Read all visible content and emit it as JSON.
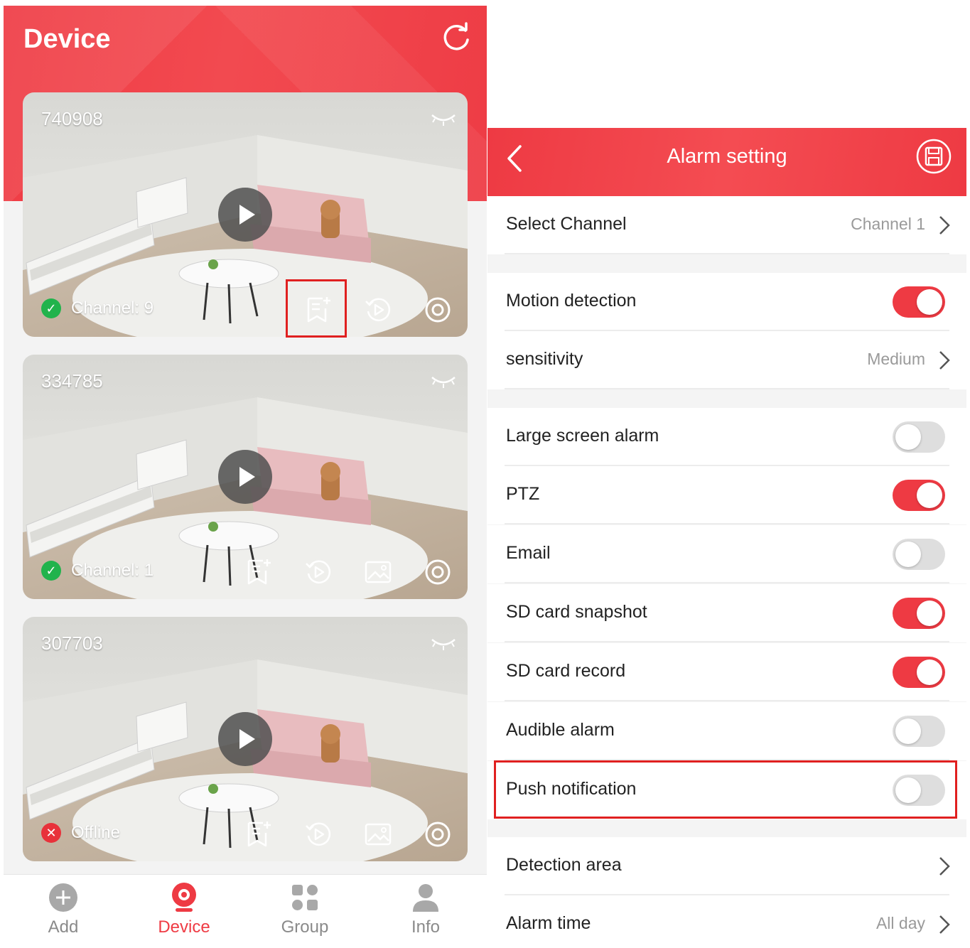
{
  "colors": {
    "accent": "#ee3a43",
    "online": "#21b34c",
    "offline": "#e8313a",
    "highlight": "#e02020"
  },
  "left": {
    "title": "Device",
    "refresh_icon": "refresh-icon",
    "cameras": [
      {
        "id": "740908",
        "status": "Channel: 9",
        "online": true,
        "actions": [
          "add-record-icon",
          "playback-icon",
          "settings-icon"
        ]
      },
      {
        "id": "334785",
        "status": "Channel: 1",
        "online": true,
        "actions": [
          "add-record-icon",
          "playback-icon",
          "image-icon",
          "settings-icon"
        ]
      },
      {
        "id": "307703",
        "status": "Offline",
        "online": false,
        "actions": [
          "add-record-icon",
          "playback-icon",
          "image-icon",
          "settings-icon"
        ]
      }
    ],
    "tabs": [
      {
        "label": "Add",
        "icon": "add-icon",
        "active": false
      },
      {
        "label": "Device",
        "icon": "camera-icon",
        "active": true
      },
      {
        "label": "Group",
        "icon": "grid-icon",
        "active": false
      },
      {
        "label": "Info",
        "icon": "user-icon",
        "active": false
      }
    ]
  },
  "right": {
    "title": "Alarm setting",
    "select_channel": {
      "label": "Select Channel",
      "value": "Channel 1"
    },
    "motion_detection": {
      "label": "Motion detection",
      "on": true
    },
    "sensitivity": {
      "label": "sensitivity",
      "value": "Medium"
    },
    "large_screen_alarm": {
      "label": "Large screen alarm",
      "on": false
    },
    "ptz": {
      "label": "PTZ",
      "on": true
    },
    "email": {
      "label": "Email",
      "on": false
    },
    "sd_snapshot": {
      "label": "SD card snapshot",
      "on": true
    },
    "sd_record": {
      "label": "SD card record",
      "on": true
    },
    "audible_alarm": {
      "label": "Audible alarm",
      "on": false
    },
    "push_notification": {
      "label": "Push notification",
      "on": false
    },
    "detection_area": {
      "label": "Detection area"
    },
    "alarm_time": {
      "label": "Alarm time",
      "value": "All day"
    }
  }
}
